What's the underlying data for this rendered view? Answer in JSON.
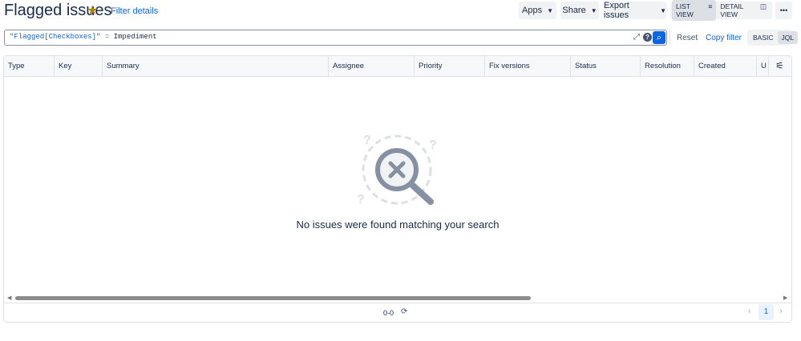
{
  "header": {
    "title": "Flagged issues",
    "filter_details": "Filter details",
    "apps": "Apps",
    "share": "Share",
    "export": "Export issues",
    "list_view": "LIST VIEW",
    "detail_view": "DETAIL VIEW",
    "more": "•••"
  },
  "search": {
    "query_field": "\"Flagged[Checkboxes]\"",
    "query_op": " = ",
    "query_value": "Impediment",
    "reset": "Reset",
    "copy_filter": "Copy filter",
    "basic": "BASIC",
    "jql": "JQL"
  },
  "columns": [
    "Type",
    "Key",
    "Summary",
    "Assignee",
    "Priority",
    "Fix versions",
    "Status",
    "Resolution",
    "Created",
    "U"
  ],
  "empty": {
    "message": "No issues were found matching your search"
  },
  "footer": {
    "range": "0-0",
    "page": "1"
  }
}
